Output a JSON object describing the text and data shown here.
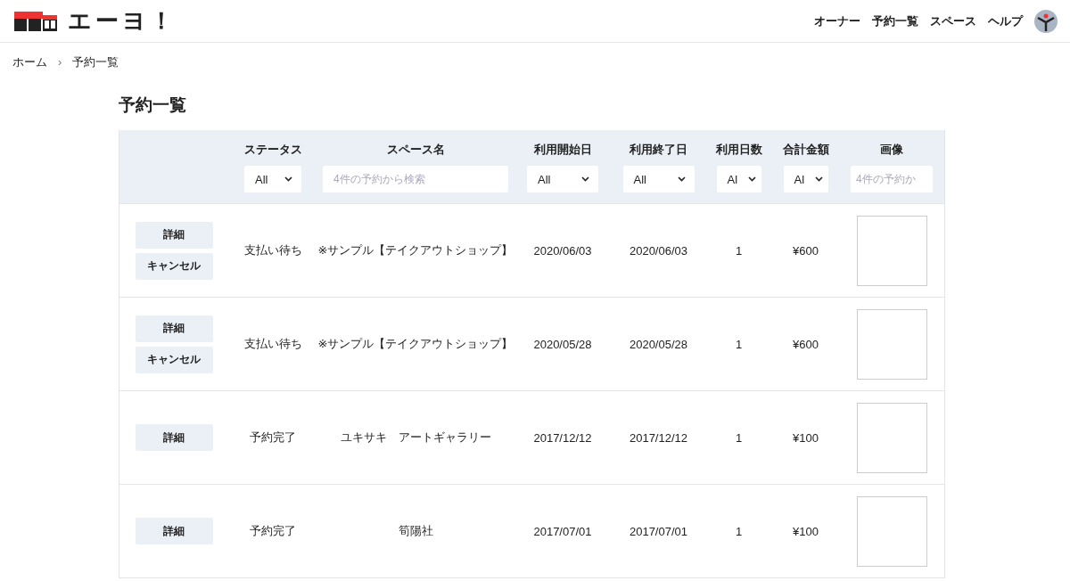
{
  "header": {
    "logo_text": "エーヨ！",
    "nav": [
      "オーナー",
      "予約一覧",
      "スペース",
      "ヘルプ"
    ]
  },
  "breadcrumb": [
    "ホーム",
    "›",
    "予約一覧"
  ],
  "page_title": "予約一覧",
  "table": {
    "columns": [
      {
        "label": "ステータス",
        "filter": {
          "kind": "select",
          "value": "All"
        }
      },
      {
        "label": "スペース名",
        "filter": {
          "kind": "text",
          "placeholder": "4件の予約から検索"
        }
      },
      {
        "label": "利用開始日",
        "filter": {
          "kind": "select",
          "value": "All"
        }
      },
      {
        "label": "利用終了日",
        "filter": {
          "kind": "select",
          "value": "All"
        }
      },
      {
        "label": "利用日数",
        "filter": {
          "kind": "select",
          "value": "Al"
        }
      },
      {
        "label": "合計金額",
        "filter": {
          "kind": "select",
          "value": "Al"
        }
      },
      {
        "label": "画像",
        "filter": {
          "kind": "text",
          "placeholder": "4件の予約か"
        }
      }
    ],
    "rows": [
      {
        "buttons": [
          "詳細",
          "キャンセル"
        ],
        "status": "支払い待ち",
        "space": "※サンプル【テイクアウトショップ】",
        "start": "2020/06/03",
        "end": "2020/06/03",
        "days": "1",
        "total": "¥600"
      },
      {
        "buttons": [
          "詳細",
          "キャンセル"
        ],
        "status": "支払い待ち",
        "space": "※サンプル【テイクアウトショップ】",
        "start": "2020/05/28",
        "end": "2020/05/28",
        "days": "1",
        "total": "¥600"
      },
      {
        "buttons": [
          "詳細"
        ],
        "status": "予約完了",
        "space": "ユキサキ　アートギャラリー",
        "start": "2017/12/12",
        "end": "2017/12/12",
        "days": "1",
        "total": "¥100"
      },
      {
        "buttons": [
          "詳細"
        ],
        "status": "予約完了",
        "space": "筍陽社",
        "start": "2017/07/01",
        "end": "2017/07/01",
        "days": "1",
        "total": "¥100"
      }
    ]
  }
}
